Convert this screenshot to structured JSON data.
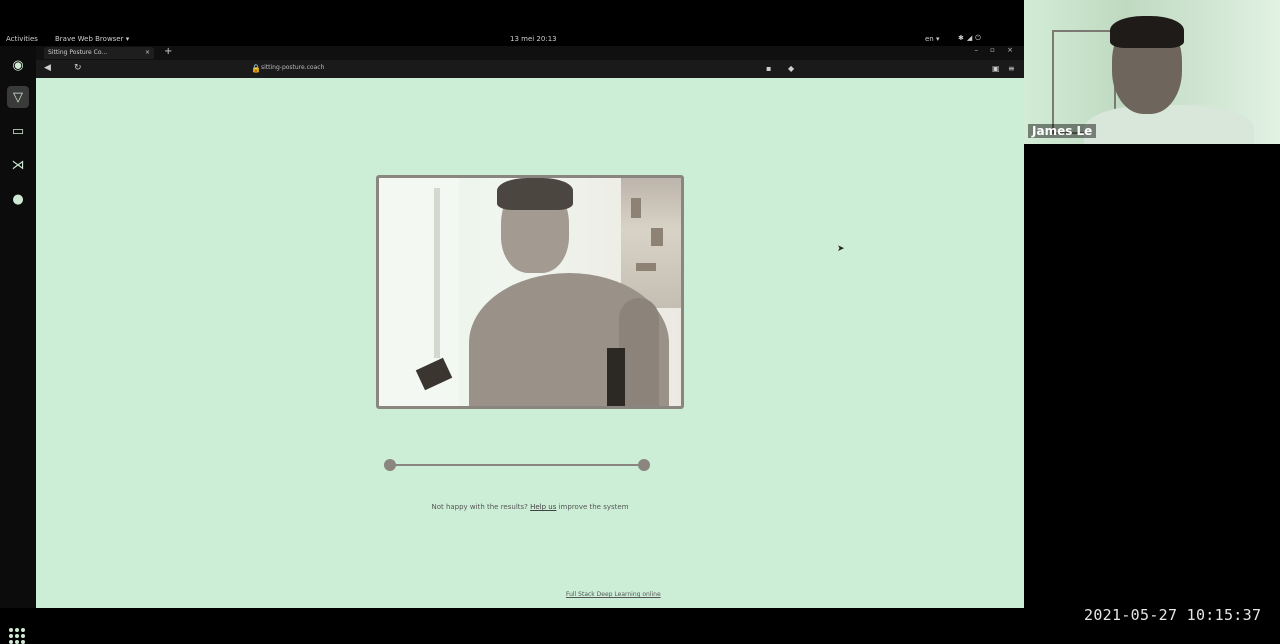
{
  "topbar": {
    "activities": "Activities",
    "app_name": "Brave Web Browser ▾",
    "clock": "13 mei  20:13",
    "language": "en ▾",
    "tray_icons": [
      "network-icon",
      "volume-icon",
      "power-icon"
    ]
  },
  "dock": {
    "items": [
      {
        "icon": "chrome-icon"
      },
      {
        "icon": "brave-icon",
        "active": true
      },
      {
        "icon": "files-icon"
      },
      {
        "icon": "vscode-icon"
      },
      {
        "icon": "chat-icon"
      }
    ],
    "apps_icon": "show-applications-icon"
  },
  "browser": {
    "tab_title": "Sitting Posture Co...",
    "tab_close": "×",
    "new_tab": "+",
    "window_controls": "– ▫ ×",
    "back_icon": "◀",
    "reload_icon": "↻",
    "address": "sitting-posture.coach"
  },
  "page": {
    "feedback_prefix": "Not happy with the results? ",
    "feedback_link": "Help us",
    "feedback_suffix": " improve the system",
    "footer_link": "Full Stack Deep Learning online"
  },
  "video": {
    "participant_name": "James Le"
  },
  "recording": {
    "timestamp": "2021-05-27 10:15:37"
  },
  "colors": {
    "page_background": "#cdeed6",
    "frame": "#8a857e",
    "outer": "#000000"
  }
}
